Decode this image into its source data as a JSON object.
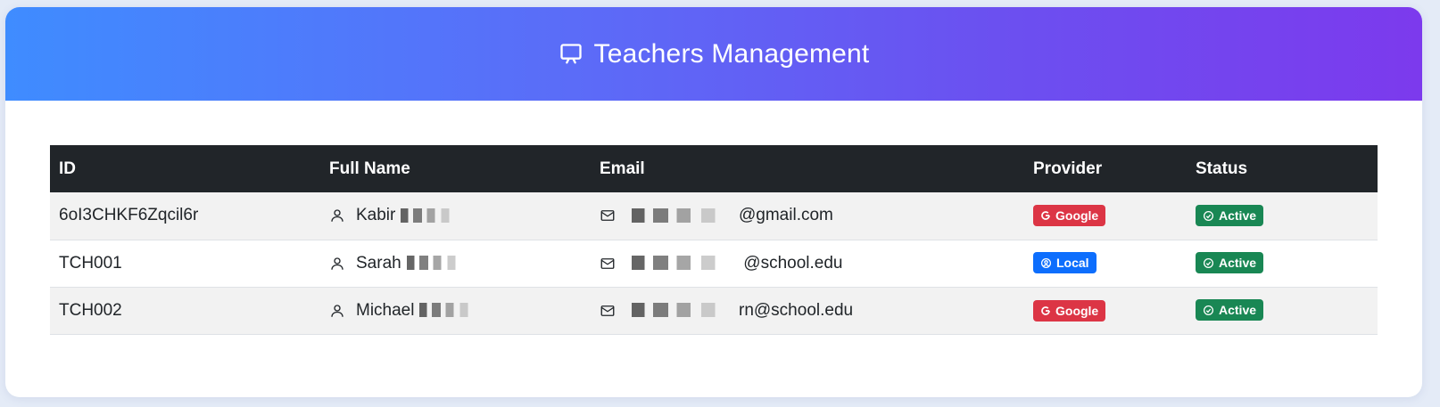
{
  "header": {
    "title": "Teachers Management",
    "icon": "presentation-board-icon"
  },
  "table": {
    "columns": [
      "ID",
      "Full Name",
      "Email",
      "Provider",
      "Status"
    ],
    "rows": [
      {
        "id": "6oI3CHKF6Zqcil6r",
        "name": "Kabir",
        "email": "@gmail.com",
        "provider": "Google",
        "provider_icon": "google-g-icon",
        "status": "Active"
      },
      {
        "id": "TCH001",
        "name": "Sarah",
        "email": "@school.edu",
        "provider": "Local",
        "provider_icon": "user-circle-icon",
        "status": "Active"
      },
      {
        "id": "TCH002",
        "name": "Michael",
        "email": "rn@school.edu",
        "provider": "Google",
        "provider_icon": "google-g-icon",
        "status": "Active"
      }
    ]
  },
  "colors": {
    "header_gradient_start": "#3f8cff",
    "header_gradient_end": "#7c3aed",
    "table_head_bg": "#212529",
    "google_badge": "#dc3545",
    "local_badge": "#0d6efd",
    "active_badge": "#198754"
  }
}
